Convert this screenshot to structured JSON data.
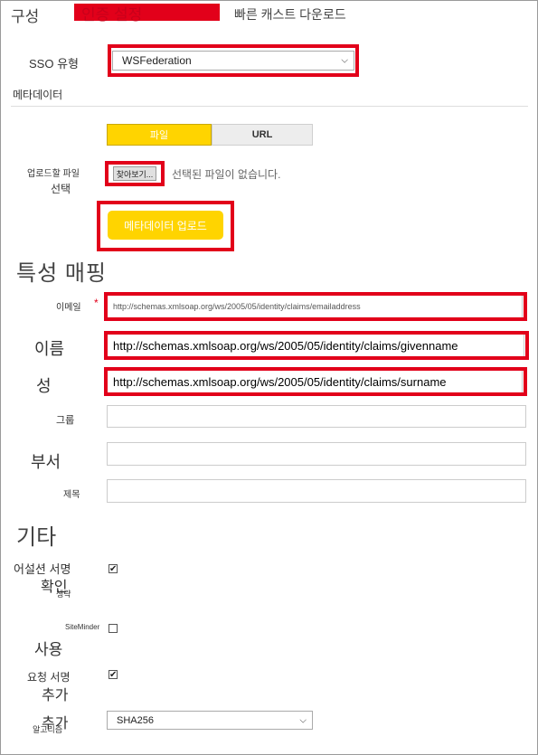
{
  "tabs": {
    "config": "구성",
    "auth_settings": "인증 설정",
    "quick_cast_download": "빠른 캐스트 다운로드"
  },
  "sso": {
    "label": "SSO 유형",
    "selected": "WSFederation"
  },
  "metadata": {
    "section_label": "메타데이터",
    "toggle_file": "파일",
    "toggle_url": "URL",
    "upload_label_line1": "업로드할 파일",
    "upload_label_line2": "선택",
    "browse_button": "찾아보기...",
    "no_file_text": "선택된 파일이 없습니다.",
    "upload_button": "메타데이터 업로드"
  },
  "attribute_mapping": {
    "heading": "특성 매핑",
    "required_mark": "*",
    "email_label": "이메일",
    "email_value": "http://schemas.xmlsoap.org/ws/2005/05/identity/claims/emailaddress",
    "first_name_label": "이름",
    "first_name_value": "http://schemas.xmlsoap.org/ws/2005/05/identity/claims/givenname",
    "last_name_label": "성",
    "last_name_value": "http://schemas.xmlsoap.org/ws/2005/05/identity/claims/surname",
    "group_label": "그룹",
    "group_value": "",
    "department_label": "부서",
    "department_value": "",
    "title_label": "제목",
    "title_value": ""
  },
  "other": {
    "heading": "기타",
    "assertion_sig_line1": "어설션 서명",
    "assertion_sig_line2": "확인",
    "assertion_sig_line3": "생략",
    "assertion_checked": true,
    "siteminder_label": "SiteMinder",
    "siteminder_line2": "사용",
    "siteminder_checked": false,
    "request_sig_line1": "요청 서명",
    "request_sig_line2": "추가",
    "request_checked": true,
    "algorithm_line1": "추가",
    "algorithm_line2": "알고리즘",
    "algorithm_selected": "SHA256"
  },
  "colors": {
    "accent_red": "#e2001a",
    "button_yellow": "#ffd400",
    "toggle_gray": "#ededed"
  },
  "icons": {
    "select_chevron": "chevron-down-icon",
    "check": "checkmark-icon"
  }
}
